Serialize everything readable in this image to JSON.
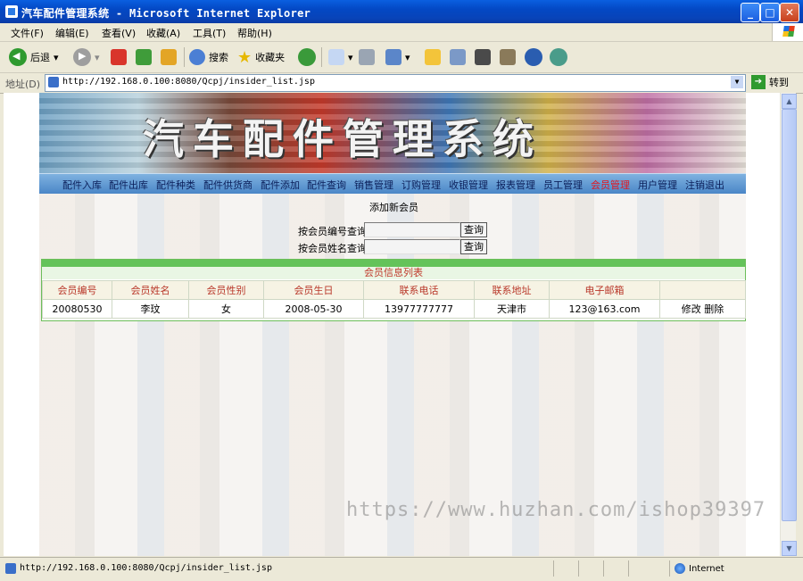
{
  "window": {
    "title": "汽车配件管理系统 - Microsoft Internet Explorer",
    "controls": [
      "_",
      "□",
      "✕"
    ]
  },
  "menu": [
    "文件(F)",
    "编辑(E)",
    "查看(V)",
    "收藏(A)",
    "工具(T)",
    "帮助(H)"
  ],
  "toolbar": {
    "back_label": "后退",
    "search_label": "搜索",
    "favorites_label": "收藏夹"
  },
  "address": {
    "label": "地址(D)",
    "url": "http://192.168.0.100:8080/Qcpj/insider_list.jsp",
    "go_label": "转到"
  },
  "banner": {
    "title": "汽车配件管理系统"
  },
  "nav": {
    "items": [
      "配件入库",
      "配件出库",
      "配件种类",
      "配件供货商",
      "配件添加",
      "配件查询",
      "销售管理",
      "订购管理",
      "收银管理",
      "报表管理",
      "员工管理",
      "会员管理",
      "用户管理",
      "注销退出"
    ],
    "active": "会员管理"
  },
  "add_new_member": "添加新会员",
  "search": {
    "by_id_label": "按会员编号查询",
    "by_name_label": "按会员姓名查询",
    "button_label": "查询",
    "id_value": "",
    "name_value": ""
  },
  "member_list": {
    "title": "会员信息列表",
    "columns": [
      "会员编号",
      "会员姓名",
      "会员性别",
      "会员生日",
      "联系电话",
      "联系地址",
      "电子邮箱",
      ""
    ],
    "rows": [
      {
        "id": "20080530",
        "name": "李玟",
        "gender": "女",
        "birthday": "2008-05-30",
        "phone": "13977777777",
        "address": "天津市",
        "email": "123@163.com",
        "edit": "修改",
        "delete": "删除"
      }
    ]
  },
  "watermark": "https://www.huzhan.com/ishop39397",
  "status": {
    "url": "http://192.168.0.100:8080/Qcpj/insider_list.jsp",
    "zone": "Internet"
  }
}
